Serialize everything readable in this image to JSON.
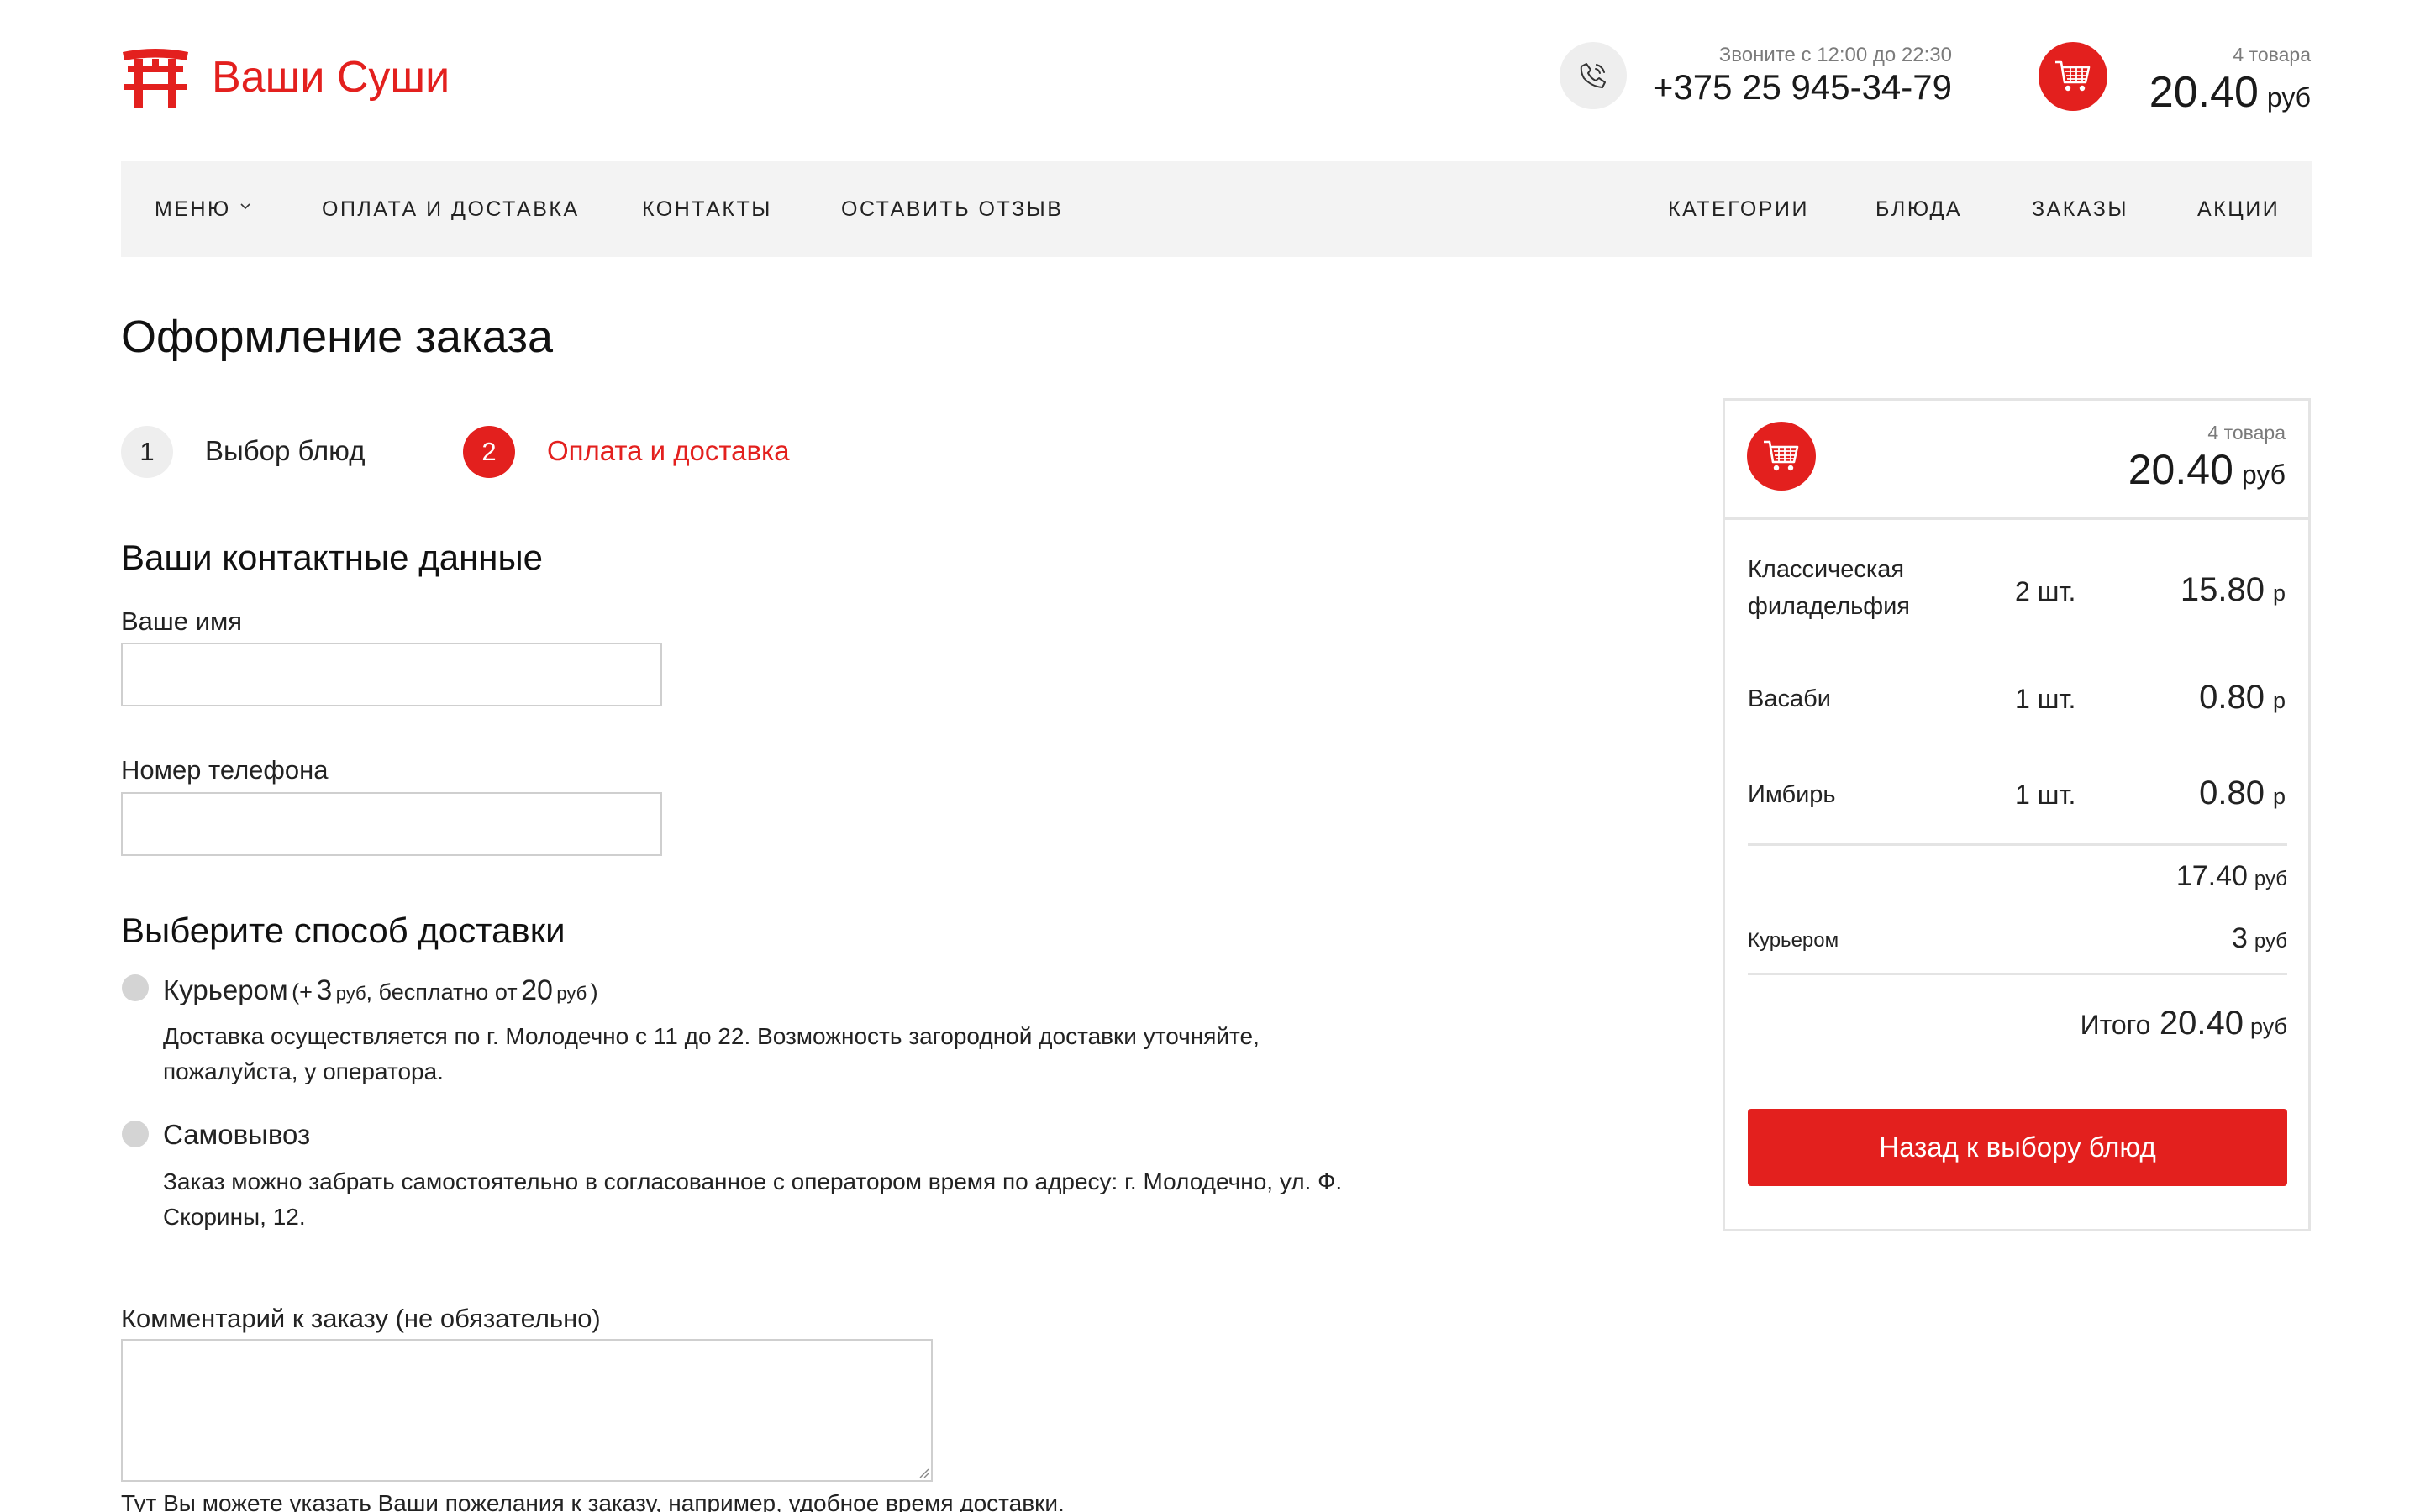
{
  "brand": {
    "name": "Ваши Суши",
    "accent": "#e3201e",
    "logo_icon": "torii-gate-icon"
  },
  "contact": {
    "hours": "Звоните с 12:00 до 22:30",
    "phone": "+375 25 945-34-79",
    "icon": "phone-icon"
  },
  "header_cart": {
    "count": "4 товара",
    "total": "20.40",
    "currency": "руб",
    "icon": "shopping-cart-icon"
  },
  "nav": {
    "left": [
      {
        "label": "МЕНЮ",
        "has_dropdown": true
      },
      {
        "label": "ОПЛАТА И ДОСТАВКА"
      },
      {
        "label": "КОНТАКТЫ"
      },
      {
        "label": "ОСТАВИТЬ ОТЗЫВ"
      }
    ],
    "right": [
      {
        "label": "КАТЕГОРИИ"
      },
      {
        "label": "БЛЮДА"
      },
      {
        "label": "ЗАКАЗЫ"
      },
      {
        "label": "АКЦИИ"
      }
    ]
  },
  "page": {
    "title": "Оформление заказа"
  },
  "steps": [
    {
      "number": "1",
      "label": "Выбор блюд",
      "active": false
    },
    {
      "number": "2",
      "label": "Оплата и доставка",
      "active": true
    }
  ],
  "form": {
    "contact_heading": "Ваши контактные данные",
    "name_label": "Ваше имя",
    "name_value": "",
    "phone_label": "Номер телефона",
    "phone_value": "",
    "delivery_heading": "Выберите способ доставки",
    "courier": {
      "label": "Курьером",
      "open_paren": "(+",
      "fee": "3",
      "fee_currency": "руб",
      "free_text": ", бесплатно от",
      "free_from": "20",
      "free_currency": "руб",
      "close_paren": ")",
      "description": "Доставка осуществляется по г. Молодечно с 11 до 22. Возможность загородной доставки уточняйте, пожалуйста, у оператора.",
      "selected": false
    },
    "pickup": {
      "label": "Самовывоз",
      "description": "Заказ можно забрать самостоятельно в согласованное с оператором время по адресу: г. Молодечно, ул. Ф. Скорины, 12.",
      "selected": false
    },
    "comment_label": "Комментарий к заказу (не обязательно)",
    "comment_value": "",
    "comment_hint": "Тут Вы можете указать Ваши пожелания к заказу, например, удобное время доставки."
  },
  "cart_panel": {
    "count": "4 товара",
    "total": "20.40",
    "currency": "руб",
    "items": [
      {
        "name": "Классическая филадельфия",
        "qty": "2 шт.",
        "price": "15.80",
        "cur": "р"
      },
      {
        "name": "Васаби",
        "qty": "1 шт.",
        "price": "0.80",
        "cur": "р"
      },
      {
        "name": "Имбирь",
        "qty": "1 шт.",
        "price": "0.80",
        "cur": "р"
      }
    ],
    "subtotal": "17.40",
    "subtotal_currency": "руб",
    "delivery_label": "Курьером",
    "delivery_price": "3",
    "delivery_currency": "руб",
    "grand_label": "Итого",
    "grand_total": "20.40",
    "grand_currency": "руб",
    "back_button": "Назад к выбору блюд"
  }
}
